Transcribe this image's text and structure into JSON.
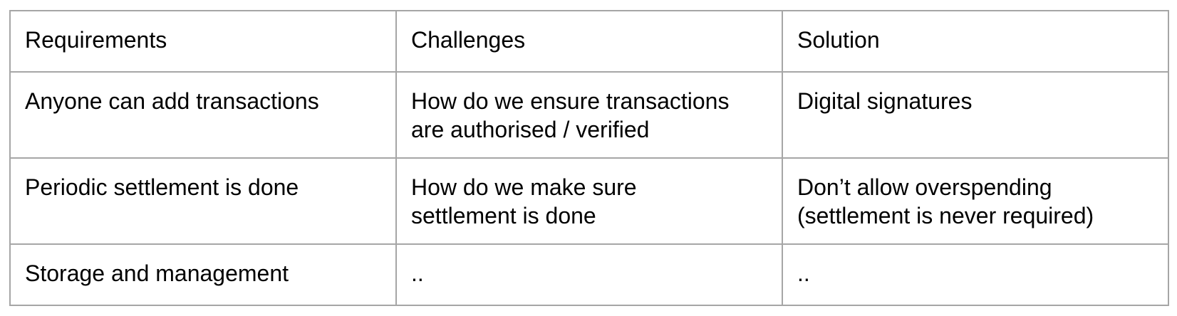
{
  "table": {
    "headers": [
      "Requirements",
      "Challenges",
      "Solution"
    ],
    "rows": [
      [
        "Anyone can add transactions",
        "How do we ensure transactions\nare authorised / verified",
        "Digital signatures"
      ],
      [
        "Periodic settlement is done",
        "How do we make sure\nsettlement is done",
        "Don’t allow overspending\n(settlement is never required)"
      ],
      [
        "Storage and management",
        "..",
        ".."
      ]
    ]
  }
}
